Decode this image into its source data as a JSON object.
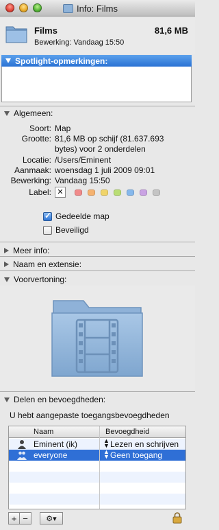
{
  "window": {
    "title": "Info: Films"
  },
  "header": {
    "name": "Films",
    "size": "81,6 MB",
    "modified": "Bewerking:  Vandaag 15:50"
  },
  "spotlight": {
    "heading": "Spotlight-opmerkingen:",
    "comments": ""
  },
  "general": {
    "heading": "Algemeen:",
    "rows": [
      {
        "label": "Soort:",
        "value": "Map"
      },
      {
        "label": "Grootte:",
        "value": "81,6 MB op schijf (81.637.693"
      },
      {
        "label": "",
        "value": "bytes) voor 2 onderdelen"
      },
      {
        "label": "Locatie:",
        "value": "/Users/Eminent"
      },
      {
        "label": "Aanmaak:",
        "value": "woensdag 1 juli 2009 09:01"
      },
      {
        "label": "Bewerking:",
        "value": "Vandaag 15:50"
      }
    ],
    "label_caption": "Label:",
    "label_none": "✕",
    "label_colors": [
      "#f08a8a",
      "#f5b270",
      "#f0d46a",
      "#b9dd74",
      "#86b8ec",
      "#c9a2e3",
      "#c4c4c4"
    ],
    "shared_folder": {
      "label": "Gedeelde map",
      "checked": true
    },
    "locked": {
      "label": "Beveiligd",
      "checked": false
    }
  },
  "collapsed_sections": {
    "more_info": "Meer info:",
    "name_ext": "Naam en extensie:"
  },
  "preview": {
    "heading": "Voorvertoning:",
    "icon": "movies-folder-icon"
  },
  "permissions": {
    "heading": "Delen en bevoegdheden:",
    "intro": "U hebt aangepaste toegangsbevoegdheden",
    "columns": {
      "name": "Naam",
      "privilege": "Bevoegdheid"
    },
    "rows": [
      {
        "name": "Eminent (ik)",
        "privilege": "Lezen en schrijven",
        "selected": false
      },
      {
        "name": "everyone",
        "privilege": "Geen toegang",
        "selected": true
      }
    ],
    "add": "+",
    "remove": "−",
    "action": "gear-icon"
  },
  "colors": {
    "accent": "#2f6fd6",
    "folder": "#8fb3d9"
  }
}
